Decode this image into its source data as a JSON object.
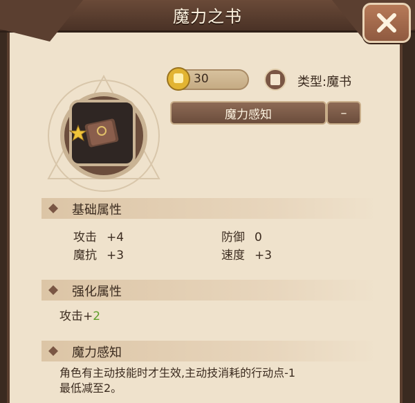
{
  "title": "魔力之书",
  "resource": {
    "value": "30",
    "icon": "fist-icon"
  },
  "type_label": "类型:魔书",
  "skill_button": "魔力感知",
  "dash_button": "–",
  "sections": {
    "basic": {
      "title": "基础属性",
      "stats": [
        {
          "name": "攻击",
          "value": "+4"
        },
        {
          "name": "防御",
          "value": "0"
        },
        {
          "name": "魔抗",
          "value": "+3"
        },
        {
          "name": "速度",
          "value": "+3"
        }
      ]
    },
    "enhance": {
      "title": "强化属性",
      "line_prefix": "攻击+",
      "line_value": "2"
    },
    "skill": {
      "title": "魔力感知",
      "line1": "角色有主动技能时才生效,主动技消耗的行动点-1",
      "line2": "最低减至2。"
    }
  },
  "colors": {
    "panel": "#efe2cc",
    "header": "#5a3e2e",
    "accent_green": "#5e9e2a"
  }
}
